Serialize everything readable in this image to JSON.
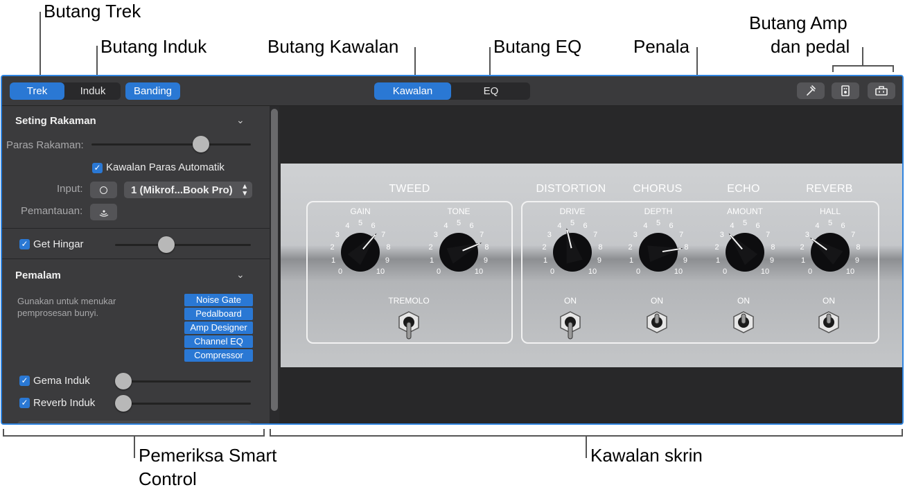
{
  "callouts": {
    "trek": "Butang Trek",
    "induk": "Butang Induk",
    "kawalan": "Butang Kawalan",
    "eq": "Butang EQ",
    "penala": "Penala",
    "amp_line1": "Butang Amp",
    "amp_line2": "dan pedal",
    "smart_line1": "Pemeriksa Smart",
    "smart_line2": "Control",
    "skrin": "Kawalan skrin"
  },
  "toolbar": {
    "trek": "Trek",
    "induk": "Induk",
    "banding": "Banding",
    "kawalan": "Kawalan",
    "eq": "EQ",
    "tuner_icon": "tuning-fork-icon",
    "amp_icon": "amp-icon",
    "pedal_icon": "pedalboard-icon",
    "accent_color": "#2a78d4"
  },
  "inspector": {
    "recording": {
      "title": "Seting Rakaman",
      "level_label": "Paras Rakaman:",
      "level_value": 0.71,
      "auto_level": "Kawalan Paras Automatik",
      "auto_level_checked": true,
      "input_label": "Input:",
      "input_value": "1  (Mikrof...Book Pro)",
      "monitoring_label": "Pemantauan:"
    },
    "noise_gate": {
      "label": "Get Hingar",
      "checked": true,
      "value": 0.36
    },
    "plugins": {
      "title": "Pemalam",
      "description_line1": "Gunakan untuk menukar",
      "description_line2": "pemprosesan bunyi.",
      "items": [
        "Noise Gate",
        "Pedalboard",
        "Amp Designer",
        "Channel EQ",
        "Compressor"
      ]
    },
    "master_echo": {
      "label": "Gema Induk",
      "checked": true,
      "value": 0
    },
    "master_reverb": {
      "label": "Reverb Induk",
      "checked": true,
      "value": 0
    }
  },
  "amp": {
    "sections": [
      "TWEED",
      "DISTORTION",
      "CHORUS",
      "ECHO",
      "REVERB"
    ],
    "knobs": [
      {
        "label": "GAIN",
        "value": 6.5
      },
      {
        "label": "TONE",
        "value": 7.5
      },
      {
        "label": "DRIVE",
        "value": 4.5
      },
      {
        "label": "DEPTH",
        "value": 8.0
      },
      {
        "label": "AMOUNT",
        "value": 3.5
      },
      {
        "label": "HALL",
        "value": 3.0
      }
    ],
    "scale": [
      "0",
      "1",
      "2",
      "3",
      "4",
      "5",
      "6",
      "7",
      "8",
      "9",
      "10"
    ],
    "switches": [
      {
        "label": "TREMOLO",
        "on": false
      },
      {
        "label": "ON",
        "on": false
      },
      {
        "label": "ON",
        "on": true
      },
      {
        "label": "ON",
        "on": true
      },
      {
        "label": "ON",
        "on": true
      }
    ]
  }
}
